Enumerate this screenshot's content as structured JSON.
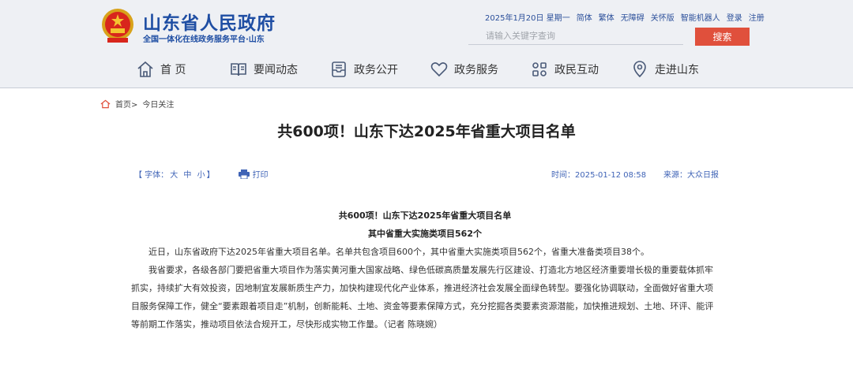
{
  "site": {
    "title": "山东省人民政府",
    "subtitle": "全国一体化在线政务服务平台·山东"
  },
  "toplinks": [
    "2025年1月20日 星期一",
    "简体",
    "繁体",
    "无障碍",
    "关怀版",
    "智能机器人",
    "登录",
    "注册"
  ],
  "search": {
    "placeholder": "请输入关键字查询",
    "button": "搜索"
  },
  "nav": [
    {
      "label": "首 页",
      "icon": "home-icon"
    },
    {
      "label": "要闻动态",
      "icon": "book-icon"
    },
    {
      "label": "政务公开",
      "icon": "inbox-icon"
    },
    {
      "label": "政务服务",
      "icon": "heart-icon"
    },
    {
      "label": "政民互动",
      "icon": "interaction-icon"
    },
    {
      "label": "走进山东",
      "icon": "location-icon"
    }
  ],
  "breadcrumb": {
    "home": "首页",
    "separator": ">",
    "current": "今日关注"
  },
  "article": {
    "title": "共600项！山东下达2025年省重大项目名单",
    "font_label": "【 字体：",
    "font_sizes": [
      "大",
      "中",
      "小"
    ],
    "font_close": "】",
    "print": "打印",
    "time": "时间：2025-01-12 08:58",
    "source": "来源：大众日报",
    "heading1": "共600项！山东下达2025年省重大项目名单",
    "heading2": "其中省重大实施类项目562个",
    "paragraphs": [
      "近日，山东省政府下达2025年省重大项目名单。名单共包含项目600个，其中省重大实施类项目562个，省重大准备类项目38个。",
      "我省要求，各级各部门要把省重大项目作为落实黄河重大国家战略、绿色低碳高质量发展先行区建设、打造北方地区经济重要增长极的重要载体抓牢抓实，持续扩大有效投资，因地制宜发展新质生产力，加快构建现代化产业体系，推进经济社会发展全面绿色转型。要强化协调联动，全面做好省重大项目服务保障工作，健全“要素跟着项目走”机制，创新能耗、土地、资金等要素保障方式，充分挖掘各类要素资源潜能，加快推进规划、土地、环评、能评等前期工作落实，推动项目依法合规开工，尽快形成实物工作量。（记者 陈晓婉）"
    ]
  },
  "colors": {
    "brand_blue": "#1f4ea3",
    "link_blue": "#3f63b6",
    "search_red": "#e0503c",
    "header_bg": "#eef0f4"
  }
}
